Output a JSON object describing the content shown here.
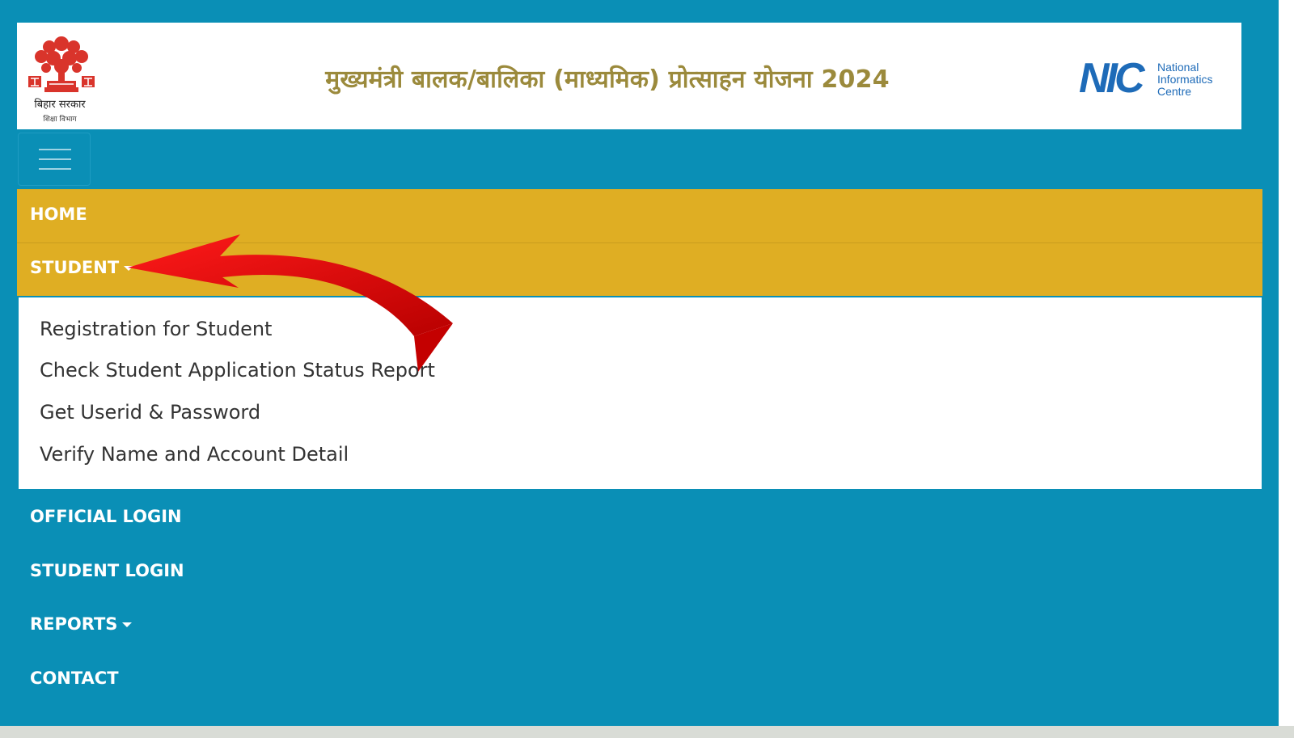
{
  "header": {
    "emblem_text": "बिहार सरकार",
    "emblem_subtext": "शिक्षा विभाग",
    "title": "मुख्यमंत्री बालक/बालिका (माध्यमिक) प्रोत्साहन योजना 2024",
    "nic_letters": "NIC",
    "nic_line1": "National",
    "nic_line2": "Informatics",
    "nic_line3": "Centre"
  },
  "nav": {
    "home": "HOME",
    "student": "STUDENT",
    "student_menu": [
      "Registration for Student",
      "Check Student Application Status Report",
      "Get Userid & Password",
      "Verify Name and Account Detail"
    ],
    "official_login": "OFFICIAL LOGIN",
    "student_login": "STUDENT LOGIN",
    "reports": "REPORTS",
    "contact": "CONTACT"
  },
  "colors": {
    "page_bg": "#0a8fb6",
    "nav_active_bg": "#dfae23",
    "title_color": "#9b8a3c",
    "nic_blue": "#1e6bb8",
    "arrow_red": "#e00000"
  }
}
